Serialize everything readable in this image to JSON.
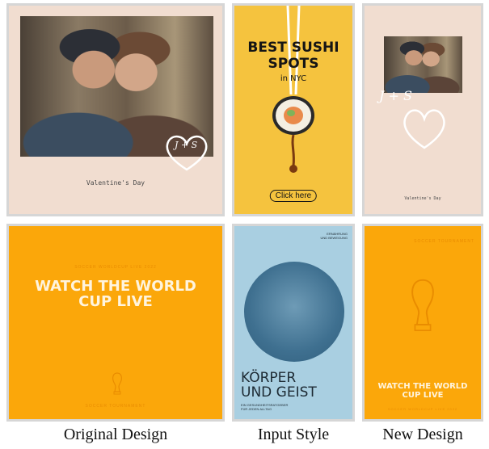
{
  "original_valentine": {
    "caption": "Valentine's Day",
    "initials": "J + S"
  },
  "sushi": {
    "line1": "BEST SUSHI",
    "line2": "SPOTS",
    "line3": "in NYC",
    "button_label": "Click here"
  },
  "new_valentine": {
    "caption": "Valentine's Day",
    "initials": "J + S"
  },
  "original_worldcup": {
    "title_line1": "WATCH THE WORLD",
    "title_line2": "CUP LIVE",
    "tagline": "SOCCER WORLDCUP LIVE 2022",
    "footer": "SOCCER TOURNAMENT"
  },
  "geist": {
    "top_line1": "ERNÄHRUNG",
    "top_line2": "UND BEWEGUNG",
    "title_line1": "KÖRPER",
    "title_line2": "UND GEIST",
    "sub_line1": "EIN GESUNDHEITSRATGEBER",
    "sub_line2": "FÜR JEDEN ALLTAG"
  },
  "new_worldcup": {
    "header": "SOCCER TOURNAMENT",
    "title_line1": "WATCH THE WORLD",
    "title_line2": "CUP LIVE",
    "tagline": "SOCCER WORLDCUP LIVE 2022"
  },
  "labels": {
    "original": "Original Design",
    "input": "Input Style",
    "new": "New Design"
  },
  "colors": {
    "blush": "#f1ddd0",
    "sushi_yellow": "#f5c33e",
    "worldcup_orange": "#fba70a",
    "geist_blue": "#a9cfe1"
  }
}
